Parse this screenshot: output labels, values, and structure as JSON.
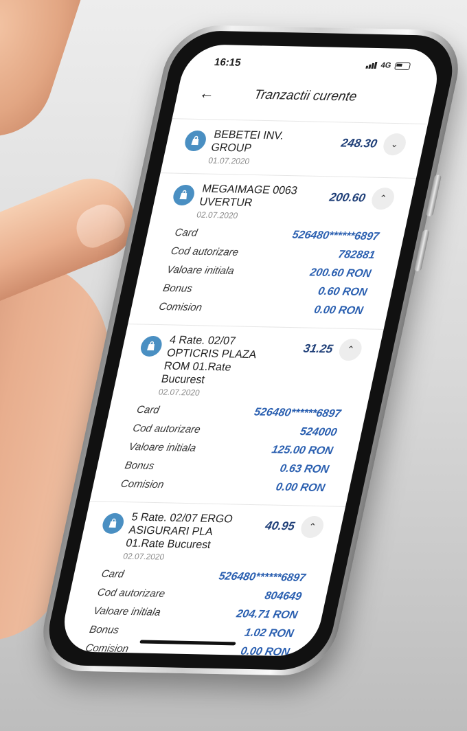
{
  "status_bar": {
    "time": "16:15",
    "network": "4G"
  },
  "header": {
    "title": "Tranzactii curente"
  },
  "transactions": [
    {
      "merchant": "BEBETEI INV. GROUP",
      "date": "01.07.2020",
      "amount": "248.30",
      "expanded": false
    },
    {
      "merchant": "MEGAIMAGE 0063 UVERTUR",
      "date": "02.07.2020",
      "amount": "200.60",
      "expanded": true,
      "details": {
        "card": "526480******6897",
        "auth_code": "782881",
        "initial_value": "200.60 RON",
        "bonus": "0.60 RON",
        "commission": "0.00 RON"
      }
    },
    {
      "merchant": "4 Rate. 02/07 OPTICRIS PLAZA ROM 01.Rate Bucurest",
      "date": "02.07.2020",
      "amount": "31.25",
      "expanded": true,
      "details": {
        "card": "526480******6897",
        "auth_code": "524000",
        "initial_value": "125.00 RON",
        "bonus": "0.63 RON",
        "commission": "0.00 RON"
      }
    },
    {
      "merchant": "5 Rate. 02/07 ERGO ASIGURARI PLA 01.Rate Bucurest",
      "date": "02.07.2020",
      "amount": "40.95",
      "expanded": true,
      "details": {
        "card": "526480******6897",
        "auth_code": "804649",
        "initial_value": "204.71 RON",
        "bonus": "1.02 RON",
        "commission": "0.00 RON"
      }
    }
  ],
  "labels": {
    "card": "Card",
    "auth_code": "Cod autorizare",
    "initial_value": "Valoare initiala",
    "bonus": "Bonus",
    "commission": "Comision"
  },
  "icons": {
    "back": "arrow-left-icon",
    "merchant": "shopping-bag-icon",
    "collapsed": "chevron-down-icon",
    "expanded": "chevron-up-icon"
  },
  "colors": {
    "amount": "#1f3f78",
    "detail_value": "#2a5fb0",
    "icon_bg": "#4a8fc2"
  }
}
